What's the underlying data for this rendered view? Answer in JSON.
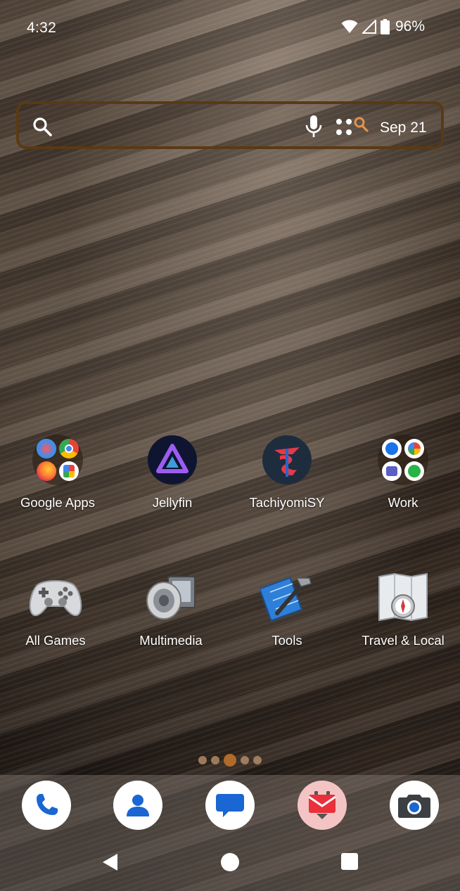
{
  "status_bar": {
    "time": "4:32",
    "battery_percent": "96%",
    "icons": [
      "wifi-icon",
      "cell-signal-icon",
      "battery-icon"
    ]
  },
  "search_widget": {
    "date": "Sep 21",
    "icons": [
      "search-icon",
      "mic-icon",
      "lens-icon"
    ]
  },
  "apps_row1": [
    {
      "label": "Google Apps",
      "type": "folder"
    },
    {
      "label": "Jellyfin",
      "type": "app"
    },
    {
      "label": "TachiyomiSY",
      "type": "app"
    },
    {
      "label": "Work",
      "type": "folder"
    }
  ],
  "apps_row2": [
    {
      "label": "All Games",
      "type": "folder"
    },
    {
      "label": "Multimedia",
      "type": "folder"
    },
    {
      "label": "Tools",
      "type": "folder"
    },
    {
      "label": "Travel & Local",
      "type": "folder"
    }
  ],
  "page_indicator": {
    "pages": 5,
    "current": 3
  },
  "dock": [
    {
      "icon": "phone-icon"
    },
    {
      "icon": "contacts-icon"
    },
    {
      "icon": "messages-icon"
    },
    {
      "icon": "mail-icon"
    },
    {
      "icon": "camera-icon"
    }
  ],
  "nav": [
    "back-icon",
    "home-icon",
    "recents-icon"
  ],
  "colors": {
    "search_border": "#5a3a14",
    "accent": "#b06a2a"
  }
}
